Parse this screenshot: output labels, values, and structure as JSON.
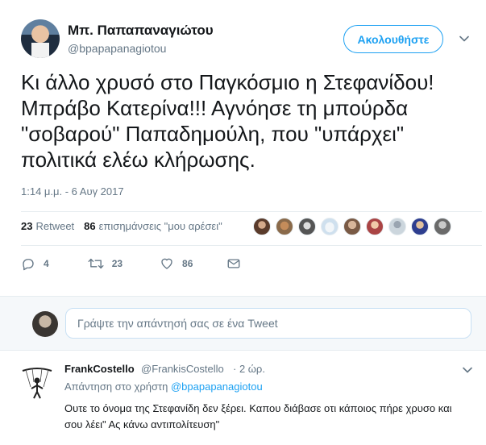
{
  "tweet": {
    "display_name": "Μπ. Παπαπαναγιώτου",
    "handle": "@bpapapanagiotou",
    "follow_label": "Ακολουθήστε",
    "text": "Κι άλλο χρυσό στο Παγκόσμιο η Στεφανίδου!\nΜπράβο Κατερίνα!!! Αγνόησε τη μπούρδα\n\"σοβαρού\" Παπαδημούλη, που \"υπάρχει\"\nπολιτικά ελέω κλήρωσης.",
    "timestamp": "1:14 μ.μ. - 6 Αυγ 2017",
    "retweets_count": "23",
    "retweets_label": "Retweet",
    "likes_count": "86",
    "likes_label": "επισημάνσεις \"μου αρέσει\"",
    "actions": {
      "replies": "4",
      "retweets": "23",
      "likes": "86"
    }
  },
  "reply_box": {
    "placeholder": "Γράψτε την απάντησή σας σε ένα Tweet"
  },
  "reply": {
    "name": "FrankCostello",
    "handle": "@FrankisCostello",
    "time": "· 2 ώρ.",
    "replying_to_prefix": "Απάντηση στο χρήστη",
    "replying_to_handle": "@bpapapanagiotou",
    "text": "Ουτε το όνομα της Στεφανίδη δεν ξέρει. Καπου διάβασε οτι κάποιος πήρε χρυσο και σου λέει\" Ας κάνω αντιπολίτευση\""
  },
  "colors": {
    "accent": "#1da1f2",
    "muted": "#657786",
    "text": "#14171a",
    "reply_bg": "#f5f8fa"
  },
  "icons": [
    "chevron-down-icon",
    "reply-icon",
    "retweet-icon",
    "heart-icon",
    "message-icon"
  ]
}
